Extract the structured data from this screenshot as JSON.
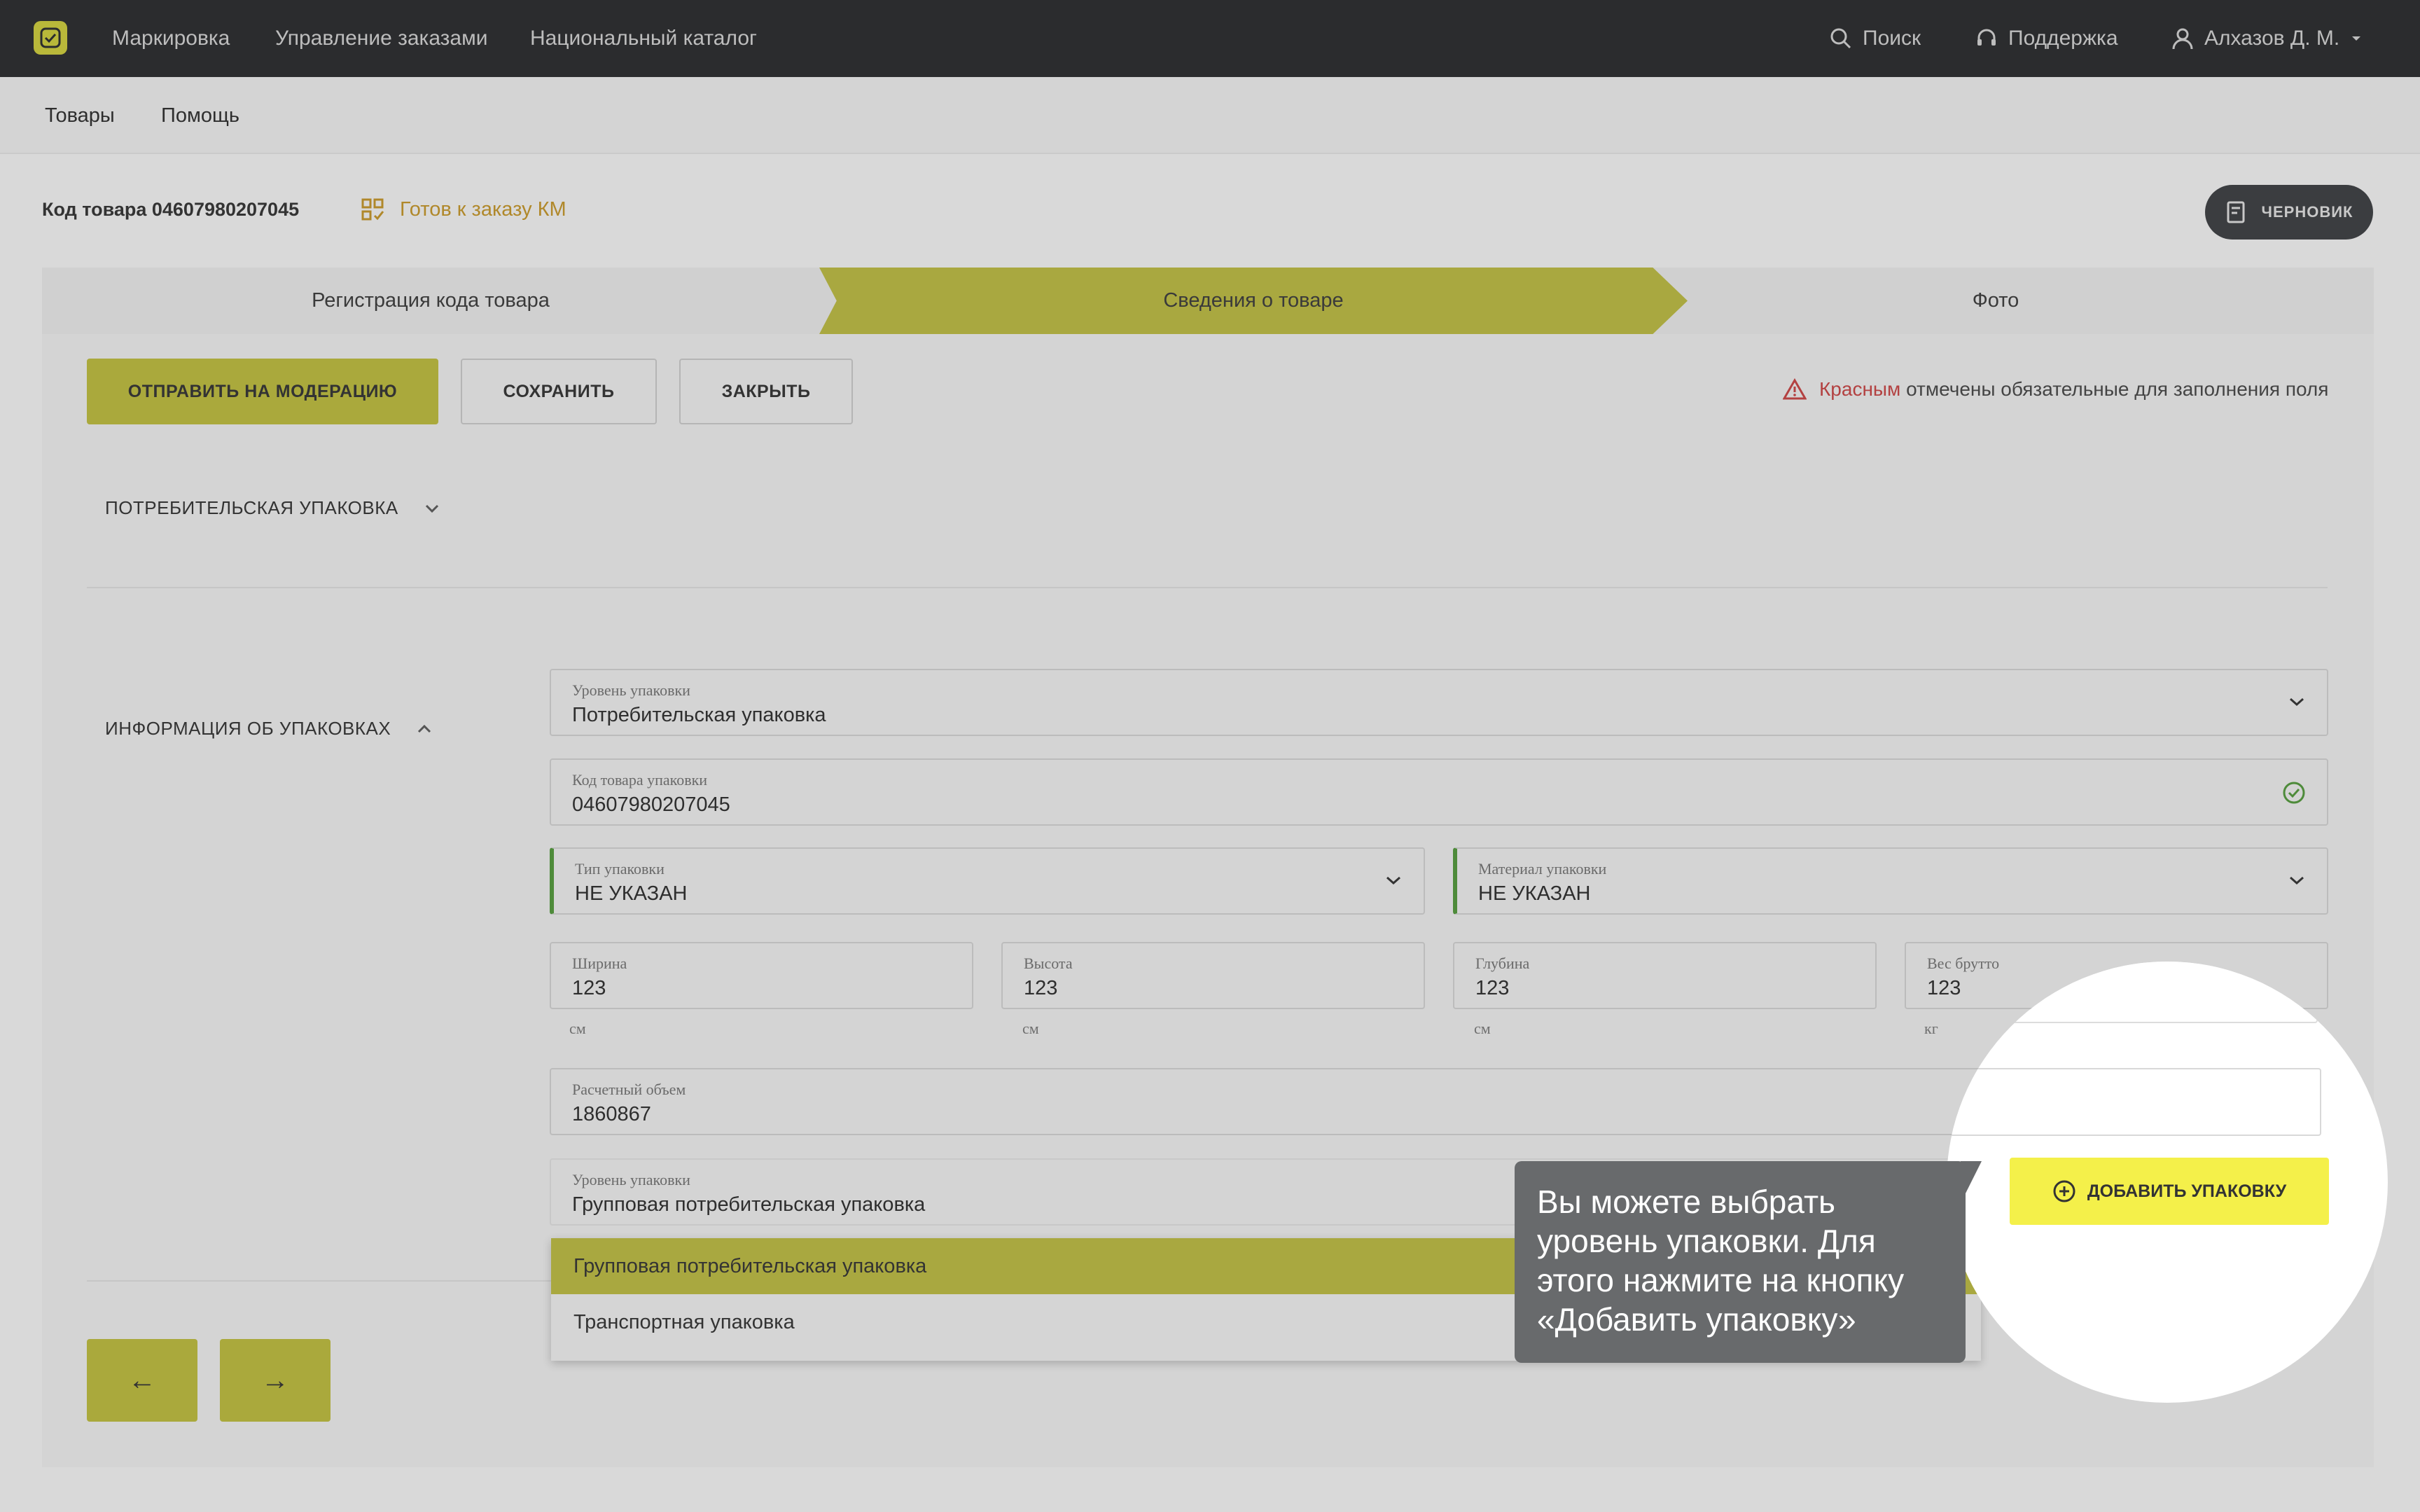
{
  "topbar": {
    "nav": [
      "Маркировка",
      "Управление заказами",
      "Национальный каталог"
    ],
    "search_label": "Поиск",
    "support_label": "Поддержка",
    "user_name": "Алхазов Д. М."
  },
  "subnav": [
    "Товары",
    "Помощь"
  ],
  "header": {
    "code_label": "Код товара 04607980207045",
    "status": "Готов к заказу КМ",
    "draft_label": "ЧЕРНОВИК"
  },
  "stepper": {
    "steps": [
      "Регистрация кода товара",
      "Сведения о товаре",
      "Фото"
    ]
  },
  "actions": {
    "submit_label": "ОТПРАВИТЬ НА МОДЕРАЦИЮ",
    "save_label": "СОХРАНИТЬ",
    "close_label": "ЗАКРЫТЬ"
  },
  "required_note": {
    "red_word": "Красным",
    "rest": "отмечены обязательные для заполнения поля"
  },
  "sections": {
    "consumer_pack": "ПОТРЕБИТЕЛЬСКАЯ УПАКОВКА",
    "pack_info": "ИНФОРМАЦИЯ ОБ УПАКОВКАХ"
  },
  "form": {
    "level": {
      "label": "Уровень упаковки",
      "value": "Потребительская упаковка"
    },
    "code": {
      "label": "Код товара упаковки",
      "value": "04607980207045"
    },
    "type": {
      "label": "Тип упаковки",
      "value": "НЕ УКАЗАН"
    },
    "material": {
      "label": "Материал упаковки",
      "value": "НЕ УКАЗАН"
    },
    "width": {
      "label": "Ширина",
      "value": "123",
      "unit": "см"
    },
    "height": {
      "label": "Высота",
      "value": "123",
      "unit": "см"
    },
    "depth": {
      "label": "Глубина",
      "value": "123",
      "unit": "см"
    },
    "weight": {
      "label": "Вес брутто",
      "value": "123",
      "unit": "кг"
    },
    "volume": {
      "label": "Расчетный объем",
      "value": "1860867"
    },
    "level2": {
      "label": "Уровень упаковки",
      "value": "Групповая потребительская упаковка"
    }
  },
  "dropdown": {
    "options": [
      "Групповая потребительская упаковка",
      "Транспортная упаковка"
    ]
  },
  "add_pack_label": "ДОБАВИТЬ УПАКОВКУ",
  "tooltip": "Вы можете выбрать уровень упаковки. Для этого нажмите на кнопку «Добавить упаковку»",
  "nav_buttons": {
    "prev": "←",
    "next": "→"
  },
  "colors": {
    "accent": "#f4f04a",
    "accent_dim": "#aaa93c",
    "topbar": "#2b2c2e",
    "required": "#b34141",
    "valid": "#4e8b3a"
  }
}
